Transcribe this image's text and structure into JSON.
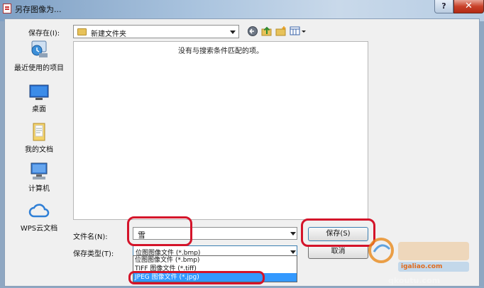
{
  "dialog": {
    "title": "另存图像为..."
  },
  "titlebar": {
    "help_label": "?",
    "close_label": "✕"
  },
  "toolbar": {
    "save_in_label": "保存在(I):",
    "current_folder": "新建文件夹",
    "icons": [
      "back-icon",
      "up-folder-icon",
      "new-folder-icon",
      "view-menu-icon"
    ]
  },
  "places": [
    {
      "label": "最近使用的项目",
      "icon": "recent-items-icon"
    },
    {
      "label": "桌面",
      "icon": "desktop-icon"
    },
    {
      "label": "我的文档",
      "icon": "documents-icon"
    },
    {
      "label": "计算机",
      "icon": "computer-icon"
    },
    {
      "label": "WPS云文档",
      "icon": "cloud-icon"
    }
  ],
  "file_list": {
    "empty_message": "没有与搜索条件匹配的项。"
  },
  "filename": {
    "label": "文件名(N):",
    "value": "雪"
  },
  "filetype": {
    "label": "保存类型(T):",
    "selected": "位图图像文件 (*.bmp)",
    "options": [
      "位图图像文件 (*.bmp)",
      "TIFF 图像文件 (*.tiff)",
      "JPEG 图像文件 (*.jpg)"
    ],
    "highlighted_index": 2
  },
  "buttons": {
    "save": "保存(S)",
    "cancel": "取消"
  },
  "watermark": {
    "site": "igaliao.com",
    "url": "qkoutu.com"
  },
  "colors": {
    "annotation_red": "#d4142a",
    "selection_blue": "#3399ff",
    "close_red": "#c8412a"
  }
}
